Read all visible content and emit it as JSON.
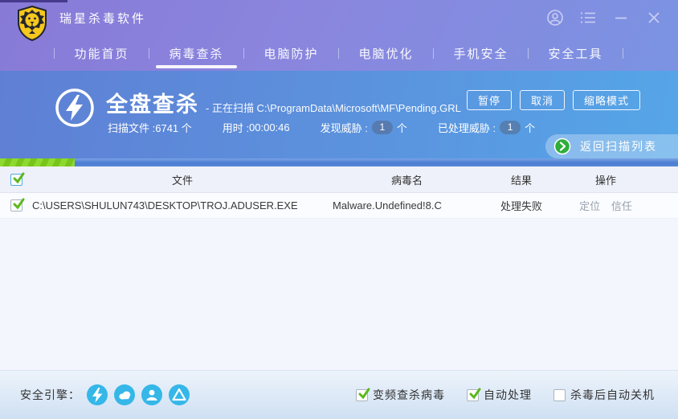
{
  "colors": {
    "header_purple": "#877ad7",
    "panel_blue": "#55a6e8",
    "progress_green": "#7ec91c",
    "engine_cyan": "#35b7e8",
    "check_green": "#5cb81e",
    "back_arrow_green": "#2fae3a"
  },
  "window": {
    "title": "瑞星杀毒软件"
  },
  "nav": {
    "tabs": [
      {
        "label": "功能首页",
        "active": false
      },
      {
        "label": "病毒查杀",
        "active": true
      },
      {
        "label": "电脑防护",
        "active": false
      },
      {
        "label": "电脑优化",
        "active": false
      },
      {
        "label": "手机安全",
        "active": false
      },
      {
        "label": "安全工具",
        "active": false
      }
    ]
  },
  "scan": {
    "title": "全盘查杀",
    "status_text": "- 正在扫描 C:\\ProgramData\\Microsoft\\MF\\Pending.GRL",
    "progress_percent": 11,
    "stats": [
      {
        "label": "扫描文件 : ",
        "value": "6741 个"
      },
      {
        "label": "用时 : ",
        "value": "00:00:46"
      },
      {
        "label": "发现威胁 : ",
        "value": "1",
        "unit": "个"
      },
      {
        "label": "已处理威胁 : ",
        "value": "1",
        "unit": "个"
      }
    ],
    "buttons": {
      "pause": "暂停",
      "cancel": "取消",
      "thumbnail_mode": "缩略模式"
    },
    "back_button": "返回扫描列表"
  },
  "table": {
    "headers": {
      "file": "文件",
      "virus": "病毒名",
      "result": "结果",
      "action": "操作"
    },
    "rows": [
      {
        "checked": true,
        "file": "C:\\USERS\\SHULUN743\\DESKTOP\\TROJ.ADUSER.EXE",
        "virus": "Malware.Undefined!8.C",
        "result": "处理失败",
        "actions": [
          "定位",
          "信任"
        ]
      }
    ]
  },
  "footer": {
    "engine_label": "安全引擎：",
    "engines": [
      "bolt-engine-icon",
      "cloud-engine-icon",
      "user-engine-icon",
      "drive-engine-icon"
    ],
    "checkboxes": [
      {
        "label": "变频查杀病毒",
        "checked": true
      },
      {
        "label": "自动处理",
        "checked": true
      },
      {
        "label": "杀毒后自动关机",
        "checked": false
      }
    ]
  }
}
